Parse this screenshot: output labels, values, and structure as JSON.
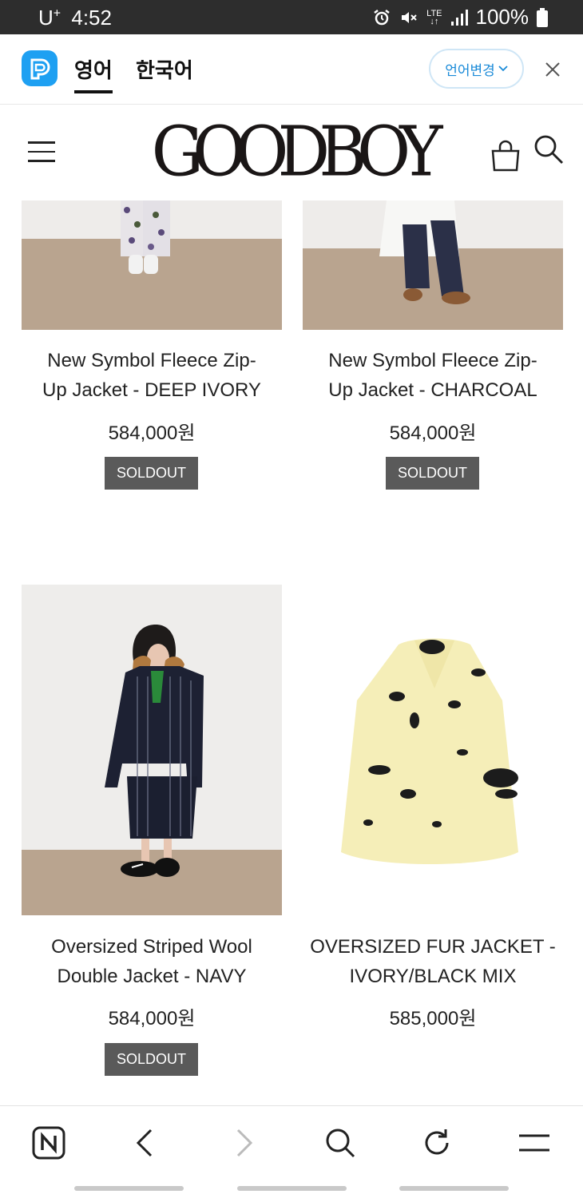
{
  "status_bar": {
    "carrier": "U",
    "carrier_sup": "+",
    "time": "4:52",
    "network": "LTE",
    "battery": "100%"
  },
  "translate_bar": {
    "tabs": [
      "영어",
      "한국어"
    ],
    "active_tab": "영어",
    "change_language_label": "언어변경",
    "accent_color": "#1ea0f2"
  },
  "header": {
    "logo_text": "GOODBOY"
  },
  "products": [
    {
      "name_line1": "New Symbol Fleece Zip-",
      "name_line2": "Up Jacket - DEEP IVORY",
      "price": "584,000원",
      "badge": "SOLDOUT"
    },
    {
      "name_line1": "New Symbol Fleece Zip-",
      "name_line2": "Up Jacket - CHARCOAL",
      "price": "584,000원",
      "badge": "SOLDOUT"
    },
    {
      "name_line1": "Oversized Striped Wool",
      "name_line2": "Double Jacket - NAVY",
      "price": "584,000원",
      "badge": "SOLDOUT"
    },
    {
      "name_line1": "OVERSIZED FUR JACKET -",
      "name_line2": "IVORY/BLACK MIX",
      "price": "585,000원",
      "badge": ""
    }
  ],
  "browser_nav": {
    "icons": [
      "naver-icon",
      "back-icon",
      "forward-icon",
      "search-icon",
      "refresh-icon",
      "menu-icon"
    ]
  }
}
